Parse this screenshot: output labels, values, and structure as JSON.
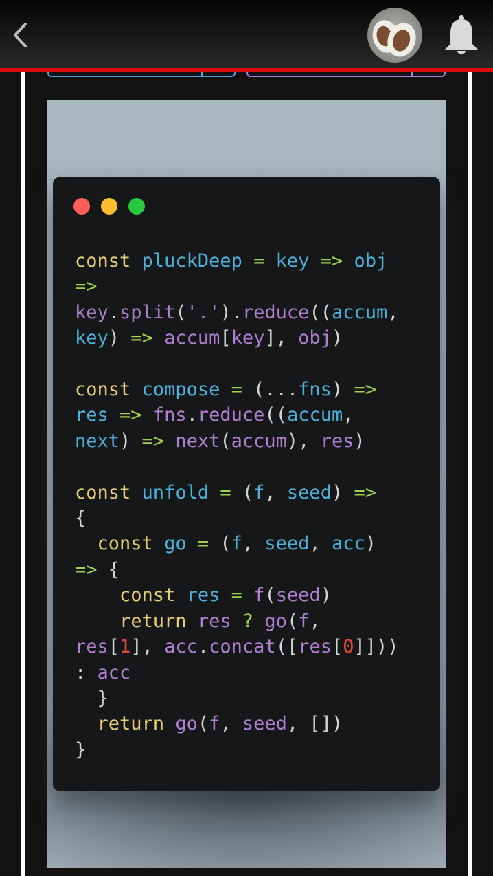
{
  "header": {
    "back_icon": "chevron-left-icon",
    "avatar_icon": "user-avatar-photo",
    "notification_icon": "bell-icon"
  },
  "colors": {
    "header_accent": "#e00d0d",
    "tab_blue": "#4fa3dc",
    "tab_purple": "#a87fd6",
    "window_red": "#ff5f57",
    "window_yellow": "#febc2e",
    "window_green": "#28c840",
    "keyword": "#e6cd76",
    "identifier": "#4eb1d9",
    "operator": "#9ed14e",
    "method": "#b07fd0",
    "number": "#e2453c"
  },
  "code_window": {
    "controls": [
      "close",
      "minimize",
      "maximize"
    ],
    "lines": [
      [
        [
          "k",
          "const"
        ],
        [
          "p",
          " "
        ],
        [
          "i",
          "pluckDeep"
        ],
        [
          "p",
          " "
        ],
        [
          "o",
          "="
        ],
        [
          "p",
          " "
        ],
        [
          "i",
          "key"
        ],
        [
          "p",
          " "
        ],
        [
          "o",
          "=>"
        ],
        [
          "p",
          " "
        ],
        [
          "i",
          "obj"
        ]
      ],
      [
        [
          "o",
          "=>"
        ]
      ],
      [
        [
          "m",
          "key"
        ],
        [
          "p",
          "."
        ],
        [
          "m",
          "split"
        ],
        [
          "p",
          "("
        ],
        [
          "m",
          "'.'"
        ],
        [
          "p",
          ")."
        ],
        [
          "m",
          "reduce"
        ],
        [
          "p",
          "(("
        ],
        [
          "i",
          "accum"
        ],
        [
          "p",
          ","
        ]
      ],
      [
        [
          "i",
          "key"
        ],
        [
          "p",
          ") "
        ],
        [
          "o",
          "=>"
        ],
        [
          "p",
          " "
        ],
        [
          "m",
          "accum"
        ],
        [
          "p",
          "["
        ],
        [
          "m",
          "key"
        ],
        [
          "p",
          "], "
        ],
        [
          "m",
          "obj"
        ],
        [
          "p",
          ")"
        ]
      ],
      [],
      [
        [
          "k",
          "const"
        ],
        [
          "p",
          " "
        ],
        [
          "i",
          "compose"
        ],
        [
          "p",
          " "
        ],
        [
          "o",
          "="
        ],
        [
          "p",
          " (..."
        ],
        [
          "i",
          "fns"
        ],
        [
          "p",
          ") "
        ],
        [
          "o",
          "=>"
        ]
      ],
      [
        [
          "i",
          "res"
        ],
        [
          "p",
          " "
        ],
        [
          "o",
          "=>"
        ],
        [
          "p",
          " "
        ],
        [
          "m",
          "fns"
        ],
        [
          "p",
          "."
        ],
        [
          "m",
          "reduce"
        ],
        [
          "p",
          "(("
        ],
        [
          "i",
          "accum"
        ],
        [
          "p",
          ","
        ]
      ],
      [
        [
          "i",
          "next"
        ],
        [
          "p",
          ") "
        ],
        [
          "o",
          "=>"
        ],
        [
          "p",
          " "
        ],
        [
          "m",
          "next"
        ],
        [
          "p",
          "("
        ],
        [
          "m",
          "accum"
        ],
        [
          "p",
          "), "
        ],
        [
          "m",
          "res"
        ],
        [
          "p",
          ")"
        ]
      ],
      [],
      [
        [
          "k",
          "const"
        ],
        [
          "p",
          " "
        ],
        [
          "i",
          "unfold"
        ],
        [
          "p",
          " "
        ],
        [
          "o",
          "="
        ],
        [
          "p",
          " ("
        ],
        [
          "i",
          "f"
        ],
        [
          "p",
          ", "
        ],
        [
          "i",
          "seed"
        ],
        [
          "p",
          ") "
        ],
        [
          "o",
          "=>"
        ]
      ],
      [
        [
          "p",
          "{"
        ]
      ],
      [
        [
          "p",
          "  "
        ],
        [
          "k",
          "const"
        ],
        [
          "p",
          " "
        ],
        [
          "i",
          "go"
        ],
        [
          "p",
          " "
        ],
        [
          "o",
          "="
        ],
        [
          "p",
          " ("
        ],
        [
          "i",
          "f"
        ],
        [
          "p",
          ", "
        ],
        [
          "i",
          "seed"
        ],
        [
          "p",
          ", "
        ],
        [
          "i",
          "acc"
        ],
        [
          "p",
          ")"
        ]
      ],
      [
        [
          "o",
          "=>"
        ],
        [
          "p",
          " {"
        ]
      ],
      [
        [
          "p",
          "    "
        ],
        [
          "k",
          "const"
        ],
        [
          "p",
          " "
        ],
        [
          "i",
          "res"
        ],
        [
          "p",
          " "
        ],
        [
          "o",
          "="
        ],
        [
          "p",
          " "
        ],
        [
          "m",
          "f"
        ],
        [
          "p",
          "("
        ],
        [
          "m",
          "seed"
        ],
        [
          "p",
          ")"
        ]
      ],
      [
        [
          "p",
          "    "
        ],
        [
          "k",
          "return"
        ],
        [
          "p",
          " "
        ],
        [
          "m",
          "res"
        ],
        [
          "p",
          " "
        ],
        [
          "o",
          "?"
        ],
        [
          "p",
          " "
        ],
        [
          "m",
          "go"
        ],
        [
          "p",
          "("
        ],
        [
          "m",
          "f"
        ],
        [
          "p",
          ","
        ]
      ],
      [
        [
          "m",
          "res"
        ],
        [
          "p",
          "["
        ],
        [
          "n",
          "1"
        ],
        [
          "p",
          "], "
        ],
        [
          "m",
          "acc"
        ],
        [
          "p",
          "."
        ],
        [
          "m",
          "concat"
        ],
        [
          "p",
          "(["
        ],
        [
          "m",
          "res"
        ],
        [
          "p",
          "["
        ],
        [
          "n",
          "0"
        ],
        [
          "p",
          "]]))"
        ]
      ],
      [
        [
          "p",
          ": "
        ],
        [
          "m",
          "acc"
        ]
      ],
      [
        [
          "p",
          "  }"
        ]
      ],
      [
        [
          "p",
          "  "
        ],
        [
          "k",
          "return"
        ],
        [
          "p",
          " "
        ],
        [
          "m",
          "go"
        ],
        [
          "p",
          "("
        ],
        [
          "m",
          "f"
        ],
        [
          "p",
          ", "
        ],
        [
          "m",
          "seed"
        ],
        [
          "p",
          ", [])"
        ]
      ],
      [
        [
          "p",
          "}"
        ]
      ]
    ]
  }
}
